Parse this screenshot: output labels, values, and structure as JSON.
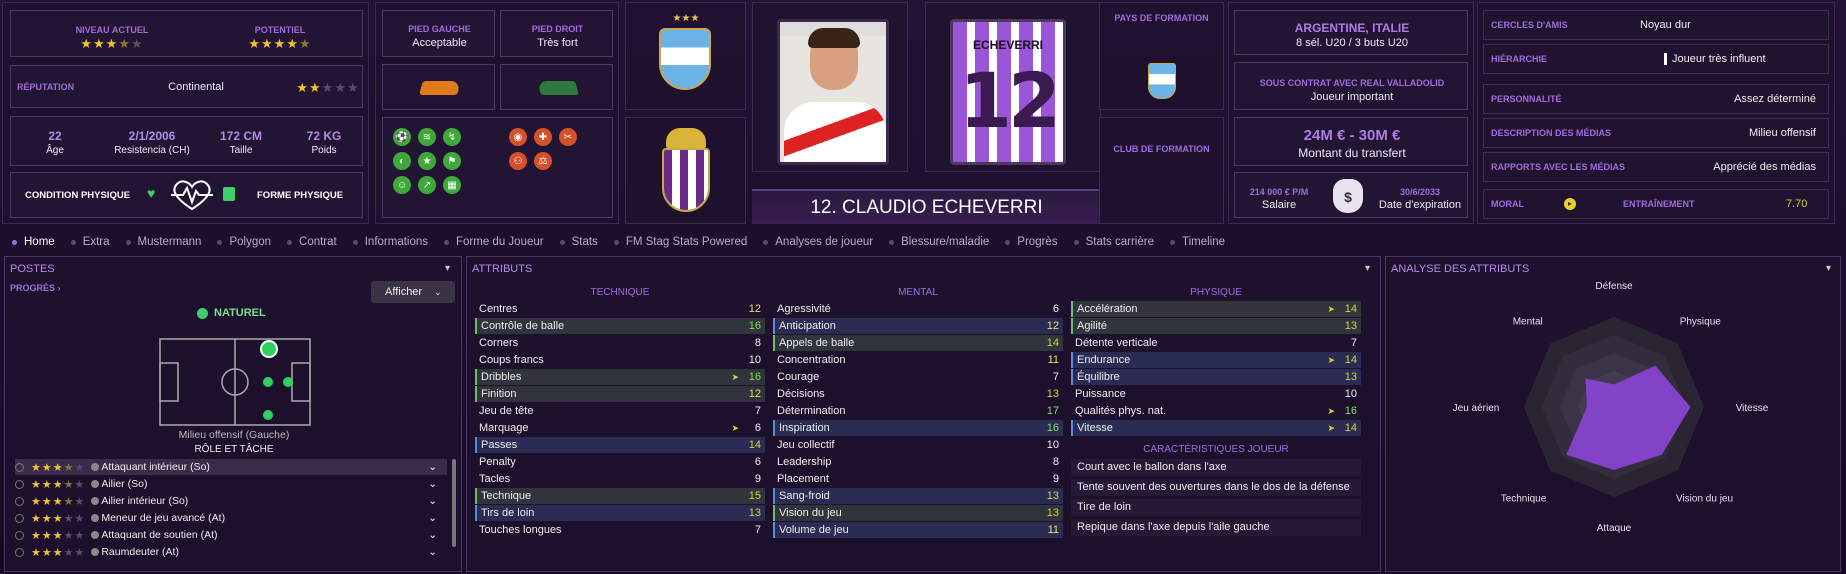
{
  "header": {
    "current_level_label": "NIVEAU ACTUEL",
    "potential_label": "POTENTIEL",
    "reputation_label": "RÉPUTATION",
    "reputation_value": "Continental",
    "age": "22",
    "age_label": "Âge",
    "birth": "2/1/2006",
    "birth_label": "Resistencia (CH)",
    "height": "172 CM",
    "height_label": "Taille",
    "weight": "72 KG",
    "weight_label": "Poids",
    "condition_label": "CONDITION PHYSIQUE",
    "form_label": "FORME PHYSIQUE",
    "left_foot_label": "PIED GAUCHE",
    "left_foot_value": "Acceptable",
    "right_foot_label": "PIED DROIT",
    "right_foot_value": "Très fort",
    "training_country_label": "PAYS DE FORMATION",
    "training_club_label": "CLUB DE FORMATION",
    "nationality": "ARGENTINE, ITALIE",
    "caps": "8 sél. U20 / 3 buts U20",
    "contract_label": "SOUS CONTRAT AVEC REAL VALLADOLID",
    "contract_status": "Joueur important",
    "transfer_value": "24M € - 30M €",
    "transfer_label": "Montant du transfert",
    "salary": "214 000 € P/M",
    "salary_label": "Salaire",
    "expiry": "30/6/2033",
    "expiry_label": "Date d'expiration",
    "player_name": "12. CLAUDIO ECHEVERRI",
    "shirt_name": "ECHEVERRI",
    "shirt_number": "12"
  },
  "side": [
    {
      "k": "CERCLES D'AMIS",
      "t": "Noyau dur"
    },
    {
      "k": "HIÉRARCHIE",
      "t": "Joueur très influent"
    },
    {
      "k": "PERSONNALITÉ",
      "t": "Assez déterminé"
    },
    {
      "k": "DESCRIPTION DES MÉDIAS",
      "t": "Milieu offensif"
    },
    {
      "k": "RAPPORTS AVEC LES MÉDIAS",
      "t": "Apprécié des médias"
    }
  ],
  "moral": {
    "label": "MORAL",
    "training_label": "ENTRAÎNEMENT",
    "training_value": "7.70"
  },
  "tabs": [
    "Home",
    "Extra",
    "Mustermann",
    "Polygon",
    "Contrat",
    "Informations",
    "Forme du Joueur",
    "Stats",
    "FM Stag Stats Powered",
    "Analyses de joueur",
    "Blessure/maladie",
    "Progrès",
    "Stats carrière",
    "Timeline"
  ],
  "positions": {
    "title": "POSTES",
    "progress": "PROGRÈS",
    "show": "Afficher",
    "natural": "NATUREL",
    "pos_name": "Milieu offensif (Gauche)",
    "role_title": "RÔLE ET TÂCHE",
    "roles": [
      "Attaquant intérieur (So)",
      "Ailier (So)",
      "Ailier intérieur (So)",
      "Meneur de jeu avancé (At)",
      "Attaquant de soutien (At)",
      "Raumdeuter (At)"
    ]
  },
  "attributes": {
    "title": "ATTRIBUTS",
    "tech_title": "TECHNIQUE",
    "mental_title": "MENTAL",
    "phys_title": "PHYSIQUE",
    "traits_title": "CARACTÉRISTIQUES JOUEUR",
    "technique": [
      [
        "Centres",
        "12"
      ],
      [
        "Contrôle de balle",
        "16"
      ],
      [
        "Corners",
        "8"
      ],
      [
        "Coups francs",
        "10"
      ],
      [
        "Dribbles",
        "16"
      ],
      [
        "Finition",
        "12"
      ],
      [
        "Jeu de tête",
        "7"
      ],
      [
        "Marquage",
        "6"
      ],
      [
        "Passes",
        "14"
      ],
      [
        "Penalty",
        "6"
      ],
      [
        "Tacles",
        "9"
      ],
      [
        "Technique",
        "15"
      ],
      [
        "Tirs de loin",
        "13"
      ],
      [
        "Touches longues",
        "7"
      ]
    ],
    "mental": [
      [
        "Agressivité",
        "6"
      ],
      [
        "Anticipation",
        "12"
      ],
      [
        "Appels de balle",
        "14"
      ],
      [
        "Concentration",
        "11"
      ],
      [
        "Courage",
        "7"
      ],
      [
        "Décisions",
        "13"
      ],
      [
        "Détermination",
        "17"
      ],
      [
        "Inspiration",
        "16"
      ],
      [
        "Jeu collectif",
        "10"
      ],
      [
        "Leadership",
        "8"
      ],
      [
        "Placement",
        "9"
      ],
      [
        "Sang-froid",
        "13"
      ],
      [
        "Vision du jeu",
        "13"
      ],
      [
        "Volume de jeu",
        "11"
      ]
    ],
    "physique": [
      [
        "Accélération",
        "14"
      ],
      [
        "Agilité",
        "13"
      ],
      [
        "Détente verticale",
        "7"
      ],
      [
        "Endurance",
        "14"
      ],
      [
        "Équilibre",
        "13"
      ],
      [
        "Puissance",
        "10"
      ],
      [
        "Qualités phys. nat.",
        "16"
      ],
      [
        "Vitesse",
        "14"
      ]
    ],
    "traits": [
      "Court avec le ballon dans l'axe",
      "Tente souvent des ouvertures dans le dos de la défense",
      "Tire de loin",
      "Repique dans l'axe depuis l'aile gauche"
    ]
  },
  "analysis": {
    "title": "ANALYSE DES ATTRIBUTS",
    "axes": [
      "Défense",
      "Physique",
      "Vitesse",
      "Vision du jeu",
      "Attaque",
      "Technique",
      "Jeu aérien",
      "Mental"
    ],
    "values": [
      0.25,
      0.65,
      0.85,
      0.75,
      0.7,
      0.75,
      0.3,
      0.45
    ]
  }
}
